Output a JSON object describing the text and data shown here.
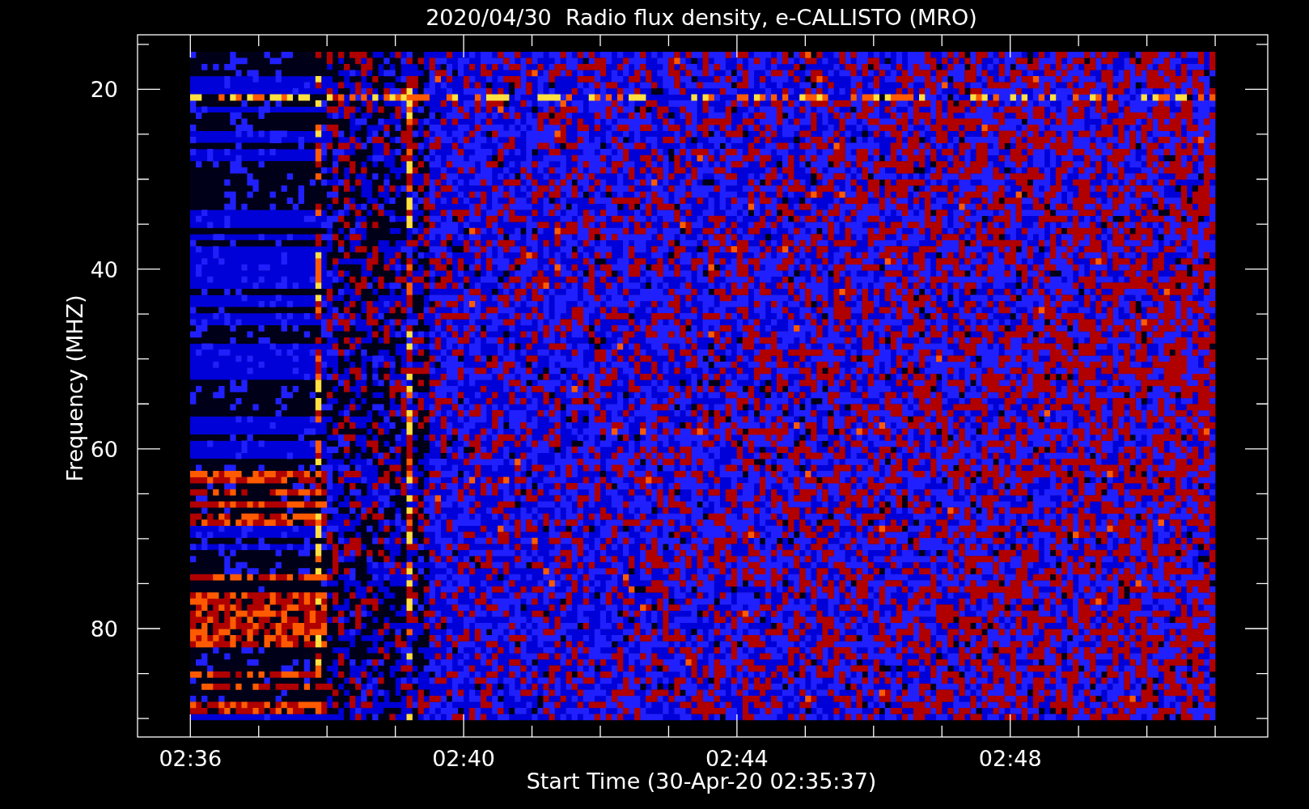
{
  "title": "2020/04/30  Radio flux density, e-CALLISTO (MRO)",
  "y_axis": {
    "label": "Frequency (MHZ)",
    "ticks": [
      "20",
      "40",
      "60",
      "80"
    ]
  },
  "x_axis": {
    "label": "Start Time (30-Apr-20 02:35:37)",
    "ticks": [
      "02:36",
      "02:40",
      "02:44",
      "02:48"
    ]
  }
}
